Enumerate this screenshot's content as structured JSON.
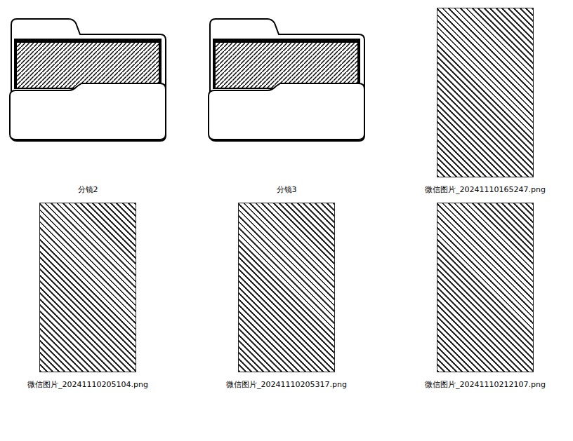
{
  "items": [
    {
      "name": "分镜2",
      "kind": "folder"
    },
    {
      "name": "分镜3",
      "kind": "folder"
    },
    {
      "name": "微信图片_20241110165247.png",
      "kind": "image"
    },
    {
      "name": "微信图片_20241110205104.png",
      "kind": "image"
    },
    {
      "name": "微信图片_20241110205317.png",
      "kind": "image"
    },
    {
      "name": "微信图片_20241110212107.png",
      "kind": "image"
    }
  ]
}
